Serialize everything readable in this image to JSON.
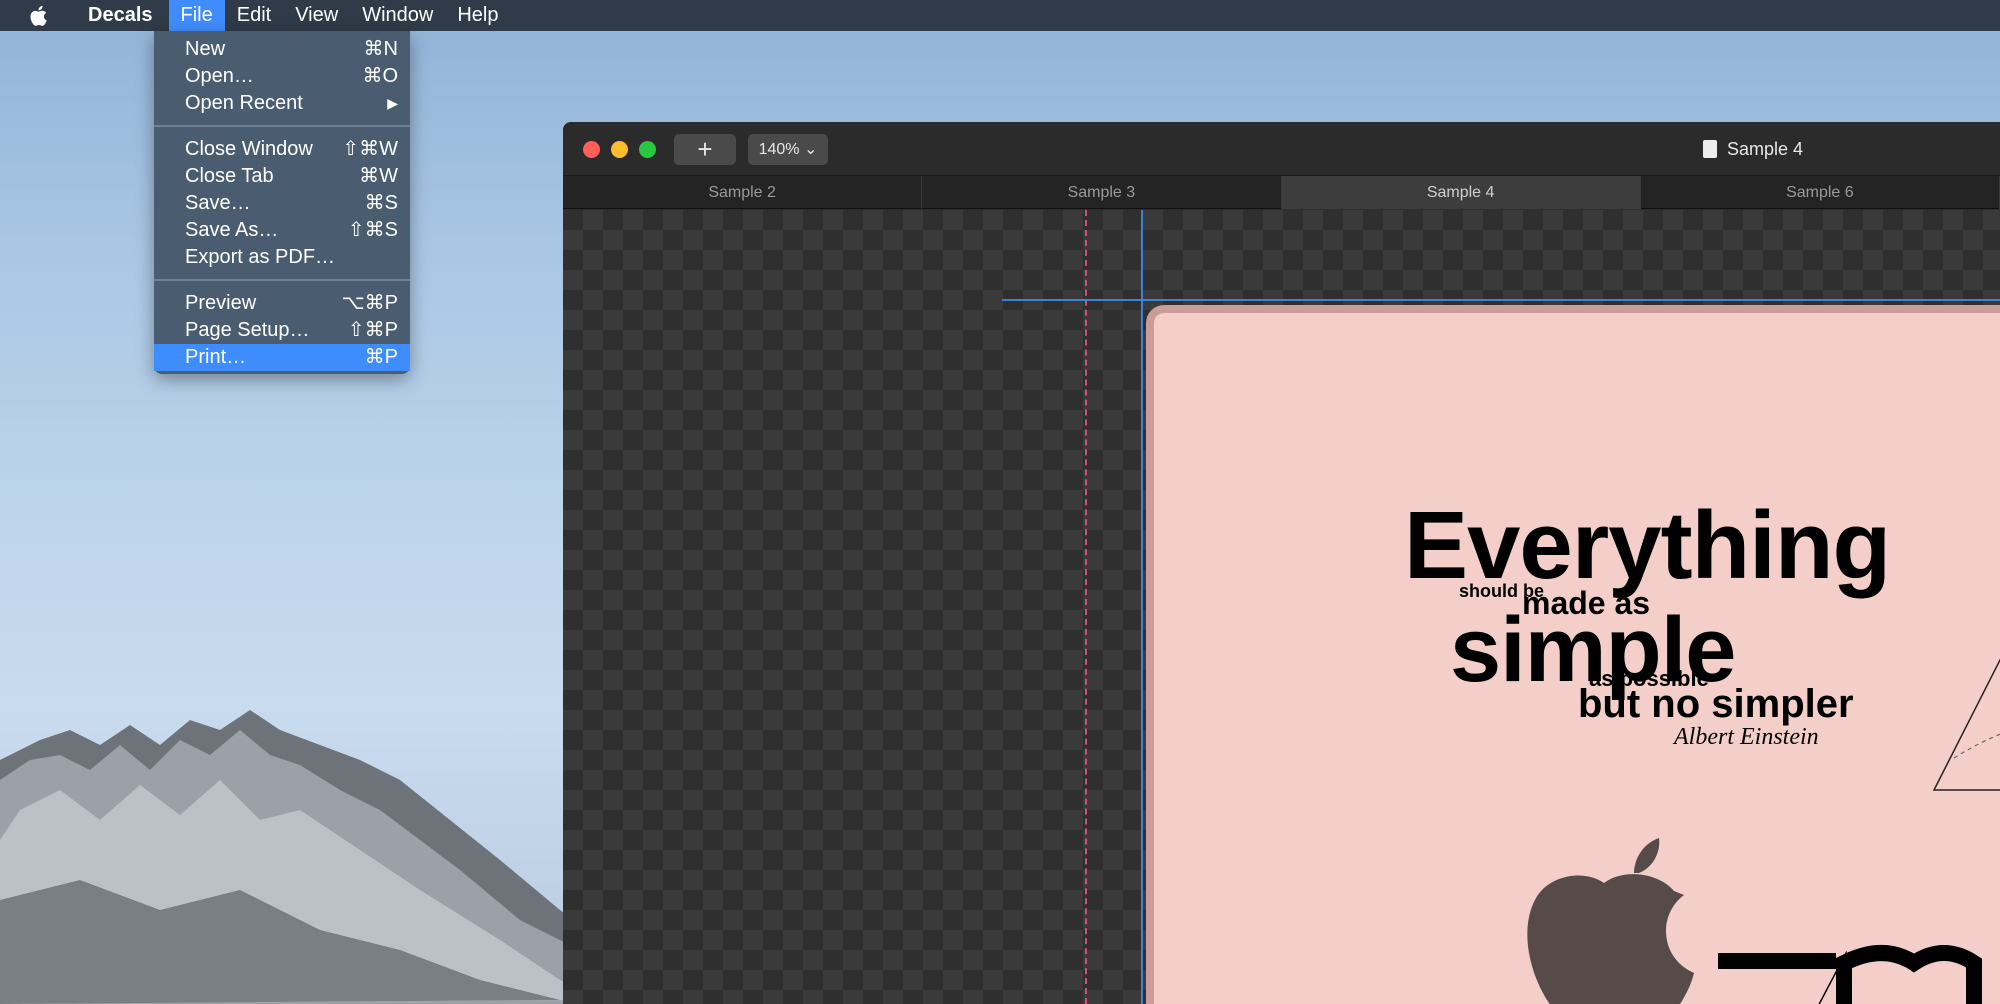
{
  "menubar": {
    "app_name": "Decals",
    "items": [
      "File",
      "Edit",
      "View",
      "Window",
      "Help"
    ]
  },
  "file_menu": {
    "items": [
      {
        "label": "New",
        "shortcut": "⌘N"
      },
      {
        "label": "Open…",
        "shortcut": "⌘O"
      },
      {
        "label": "Open Recent",
        "shortcut": "▶"
      },
      {
        "label": "Close Window",
        "shortcut": "⇧⌘W"
      },
      {
        "label": "Close Tab",
        "shortcut": "⌘W"
      },
      {
        "label": "Save…",
        "shortcut": "⌘S"
      },
      {
        "label": "Save As…",
        "shortcut": "⇧⌘S"
      },
      {
        "label": "Export as PDF…",
        "shortcut": ""
      },
      {
        "label": "Preview",
        "shortcut": "⌥⌘P"
      },
      {
        "label": "Page Setup…",
        "shortcut": "⇧⌘P"
      },
      {
        "label": "Print…",
        "shortcut": "⌘P"
      }
    ],
    "highlighted": "Print…"
  },
  "window": {
    "title": "Sample 4",
    "add_button": "+",
    "zoom": "140% ⌄",
    "tabs": [
      "Sample 2",
      "Sample 3",
      "Sample 4",
      "Sample 6"
    ],
    "active_tab": "Sample 4"
  },
  "quote": {
    "line1": "Everything",
    "line2a": "should be",
    "line2b": "made as",
    "line3": "simple",
    "line4": "as possible",
    "line5": "but no simpler",
    "author": "Albert Einstein"
  },
  "colors": {
    "menu_highlight": "#3f8dfc",
    "page_background": "#f4cfc9",
    "guide_blue": "#3d84d8",
    "guide_pink": "#d74d7e"
  },
  "icons": [
    "apple-icon",
    "document-icon",
    "apple-logo-decal"
  ]
}
